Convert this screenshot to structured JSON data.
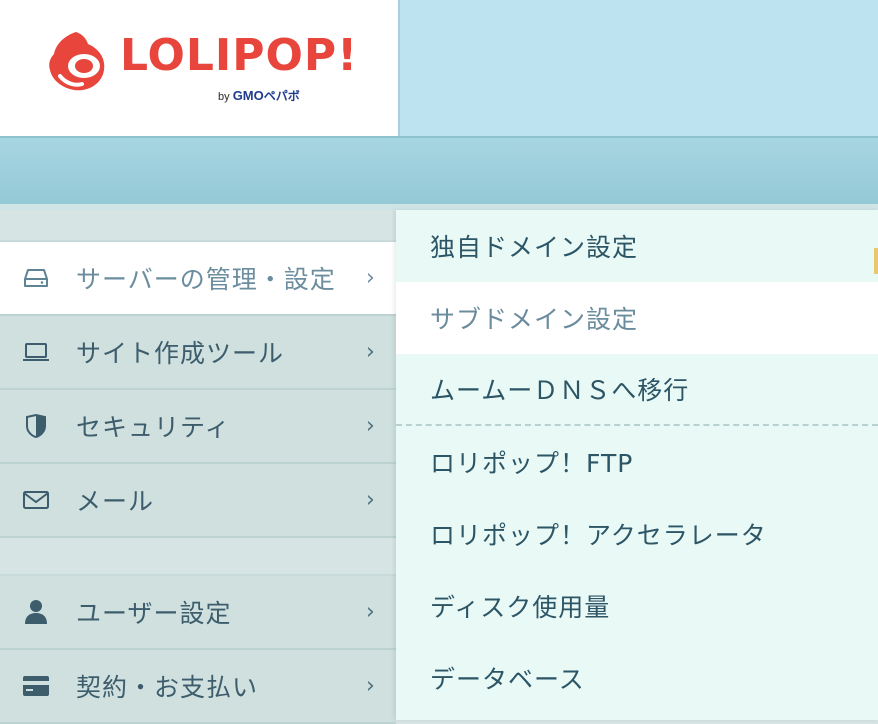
{
  "logo": {
    "brand": "LOLIPOP!",
    "by": "by",
    "gmo": "GMO",
    "company": "ペパボ",
    "accent_color": "#e8463c"
  },
  "sidebar": {
    "group1": [
      {
        "label": "サーバーの管理・設定",
        "icon": "server-icon",
        "active": true,
        "chevron": "›"
      },
      {
        "label": "サイト作成ツール",
        "icon": "laptop-icon",
        "active": false,
        "chevron": "›"
      },
      {
        "label": "セキュリティ",
        "icon": "shield-icon",
        "active": false,
        "chevron": "›"
      },
      {
        "label": "メール",
        "icon": "envelope-icon",
        "active": false,
        "chevron": "›"
      }
    ],
    "group2": [
      {
        "label": "ユーザー設定",
        "icon": "user-icon",
        "active": false,
        "chevron": "›"
      },
      {
        "label": "契約・お支払い",
        "icon": "credit-card-icon",
        "active": false,
        "chevron": "›"
      }
    ]
  },
  "submenu": {
    "items": [
      {
        "label": "独自ドメイン設定",
        "active": false
      },
      {
        "label": "サブドメイン設定",
        "active": true
      },
      {
        "label": "ムームーＤＮＳへ移行",
        "active": false
      },
      {
        "label": "ロリポップ！FTP",
        "active": false
      },
      {
        "label": "ロリポップ！アクセラレータ",
        "active": false
      },
      {
        "label": "ディスク使用量",
        "active": false
      },
      {
        "label": "データベース",
        "active": false
      }
    ]
  },
  "colors": {
    "header_right": "#bde3f1",
    "band": "#a7d6e2",
    "sidebar_bg": "#cfe0df",
    "submenu_bg": "#e9f9f6",
    "text": "#3d5d6d"
  }
}
